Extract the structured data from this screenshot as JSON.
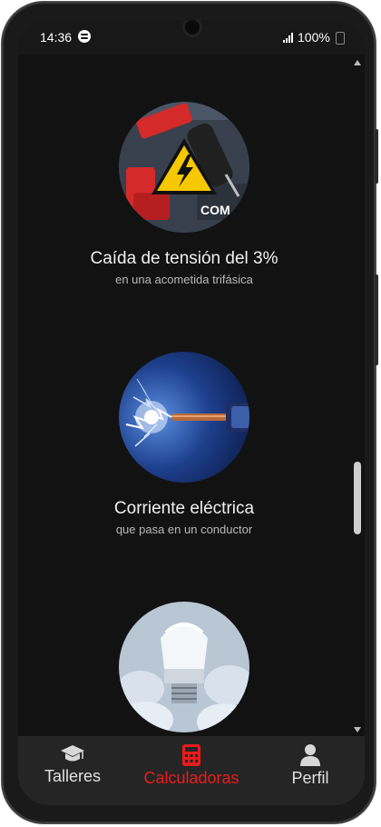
{
  "status_bar": {
    "time": "14:36",
    "battery": "100%",
    "icons": [
      "spotify-icon",
      "signal-icon",
      "battery-icon"
    ]
  },
  "cards": [
    {
      "title": "Caída de tensión del 3%",
      "subtitle": "en una acometida trifásica",
      "image": "multimeter-high-voltage-image"
    },
    {
      "title": "Corriente eléctrica",
      "subtitle": "que pasa en un conductor",
      "image": "electric-spark-wire-image"
    },
    {
      "title": "",
      "subtitle": "",
      "image": "led-bulb-image"
    }
  ],
  "bottom_nav": {
    "items": [
      {
        "label": "Talleres",
        "icon": "graduation-cap-icon",
        "active": false
      },
      {
        "label": "Calculadoras",
        "icon": "calculator-icon",
        "active": true
      },
      {
        "label": "Perfil",
        "icon": "person-icon",
        "active": false
      }
    ],
    "active_color": "#e81c1c",
    "inactive_color": "#e0e0e0"
  }
}
